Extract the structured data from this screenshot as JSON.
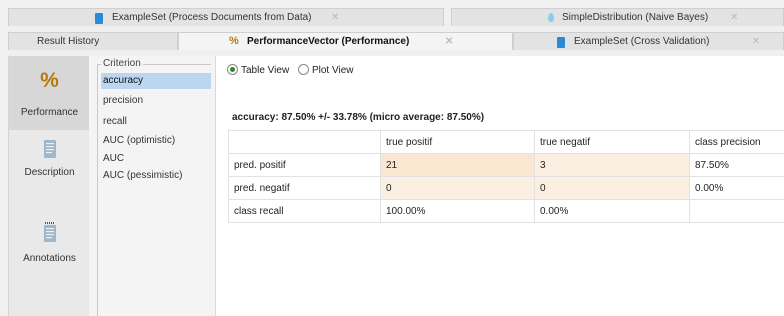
{
  "tabs_row1": [
    {
      "label": "ExampleSet (Process Documents from Data)",
      "icon": "table-icon"
    },
    {
      "label": "SimpleDistribution (Naive Bayes)",
      "icon": "droplet-icon"
    }
  ],
  "tabs_row2": [
    {
      "label": "Result History",
      "active": false
    },
    {
      "label": "PerformanceVector (Performance)",
      "icon": "percent-icon",
      "active": true
    },
    {
      "label": "ExampleSet (Cross Validation)",
      "icon": "table-icon",
      "active": false
    }
  ],
  "close_glyph": "✕",
  "sidebar": {
    "items": [
      {
        "label": "Performance",
        "icon": "percent-icon",
        "active": true
      },
      {
        "label": "Description",
        "icon": "document-icon",
        "active": false
      },
      {
        "label": "Annotations",
        "icon": "notes-icon",
        "active": false
      }
    ]
  },
  "criterion": {
    "title": "Criterion",
    "items": [
      "accuracy",
      "precision",
      "recall",
      "AUC (optimistic)",
      "AUC",
      "AUC (pessimistic)"
    ],
    "selected": "accuracy"
  },
  "view_toggle": {
    "options": [
      {
        "label": "Table View",
        "selected": true
      },
      {
        "label": "Plot View",
        "selected": false
      }
    ]
  },
  "summary": "accuracy: 87.50% +/- 33.78% (micro average: 87.50%)",
  "table": {
    "headers": [
      "",
      "true positif",
      "true negatif",
      "class precision"
    ],
    "rows": [
      [
        "pred. positif",
        "21",
        "3",
        "87.50%"
      ],
      [
        "pred. negatif",
        "0",
        "0",
        "0.00%"
      ],
      [
        "class recall",
        "100.00%",
        "0.00%",
        ""
      ]
    ]
  },
  "colors": {
    "selection": "#bcd6f2",
    "cell_highlight": "#fbe6d1",
    "cell_light": "#fbefe1",
    "radio_on": "#2a8a2a",
    "doc_icon": "#2b8ad6"
  }
}
